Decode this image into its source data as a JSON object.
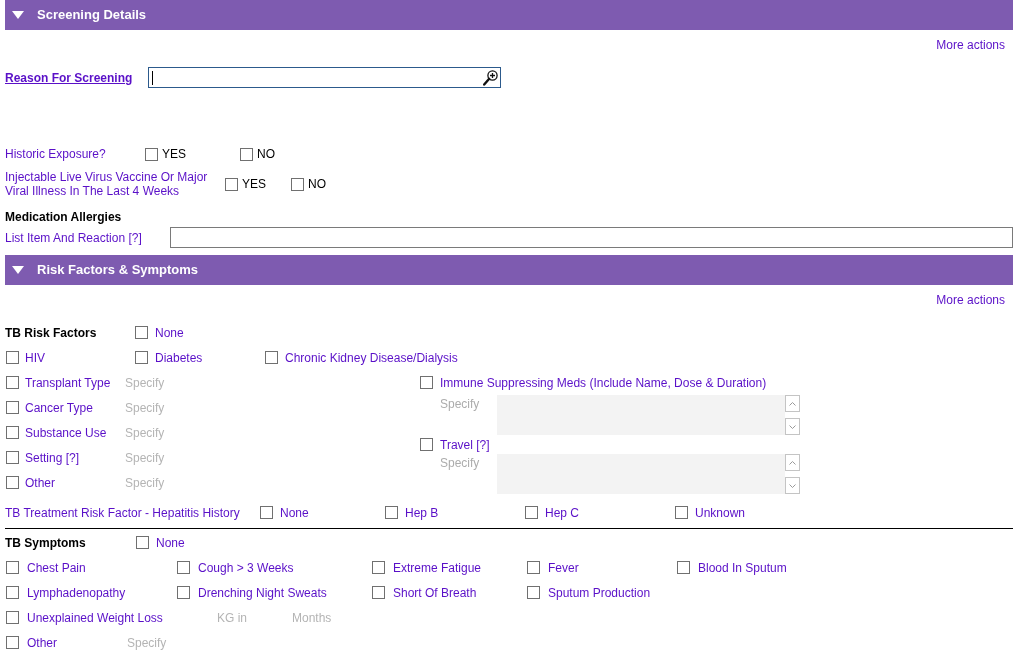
{
  "screening_details": {
    "header": {
      "title": "Screening Details",
      "expanded": true
    },
    "more_actions": "More actions",
    "reason_for_screening": {
      "label": "Reason For Screening",
      "focused": true
    },
    "questions": [
      {
        "label": "Historic Exposure?",
        "options": [
          {
            "label": "YES",
            "checked": false
          },
          {
            "label": "NO",
            "checked": false
          }
        ]
      },
      {
        "label": "Injectable Live Virus Vaccine Or Major Viral Illness In The Last 4 Weeks",
        "options": [
          {
            "label": "YES",
            "checked": false
          },
          {
            "label": "NO",
            "checked": false
          }
        ]
      }
    ],
    "medication_allergies": {
      "heading": "Medication Allergies",
      "label": "List Item And Reaction [?]"
    }
  },
  "risk_factors_and_symptoms": {
    "header": {
      "title": "Risk Factors & Symptoms",
      "expanded": true
    },
    "more_actions": "More actions",
    "tb_risk_factors": {
      "heading": "TB Risk Factors",
      "none": {
        "label": "None",
        "checked": false
      },
      "top_row": [
        {
          "label": "HIV",
          "checked": false
        },
        {
          "label": "Diabetes",
          "checked": false
        },
        {
          "label": "Chronic Kidney Disease/Dialysis",
          "checked": false
        }
      ],
      "left_items": [
        {
          "label": "Transplant Type",
          "checked": false,
          "placeholder": "Specify"
        },
        {
          "label": "Cancer Type",
          "checked": false,
          "placeholder": "Specify"
        },
        {
          "label": "Substance Use",
          "checked": false,
          "placeholder": "Specify"
        },
        {
          "label": "Setting [?]",
          "checked": false,
          "placeholder": "Specify"
        },
        {
          "label": "Other",
          "checked": false,
          "placeholder": "Specify"
        }
      ],
      "right_items": [
        {
          "label": "Immune Suppressing Meds (Include Name, Dose & Duration)",
          "checked": false,
          "specify_label": "Specify",
          "disabled": true
        },
        {
          "label": "Travel [?]",
          "checked": false,
          "specify_label": "Specify",
          "disabled": true
        }
      ]
    },
    "hepatitis_history": {
      "label": "TB Treatment Risk Factor - Hepatitis History",
      "options": [
        {
          "label": "None",
          "checked": false
        },
        {
          "label": "Hep B",
          "checked": false
        },
        {
          "label": "Hep C",
          "checked": false
        },
        {
          "label": "Unknown",
          "checked": false
        }
      ]
    },
    "tb_symptoms": {
      "heading": "TB Symptoms",
      "none": {
        "label": "None",
        "checked": false
      },
      "rows": [
        {
          "items": [
            {
              "label": "Chest Pain",
              "checked": false
            },
            {
              "label": "Cough > 3 Weeks",
              "checked": false
            },
            {
              "label": "Extreme Fatigue",
              "checked": false
            },
            {
              "label": "Fever",
              "checked": false
            },
            {
              "label": "Blood In Sputum",
              "checked": false
            }
          ]
        },
        {
          "items": [
            {
              "label": "Lymphadenopathy",
              "checked": false
            },
            {
              "label": "Drenching Night Sweats",
              "checked": false
            },
            {
              "label": "Short Of Breath",
              "checked": false
            },
            {
              "label": "Sputum Production",
              "checked": false
            }
          ]
        },
        {
          "items": [
            {
              "label": "Unexplained Weight Loss",
              "checked": false,
              "fields": [
                {
                  "placeholder": "KG in"
                },
                {
                  "placeholder": "Months"
                }
              ]
            }
          ]
        },
        {
          "items": [
            {
              "label": "Other",
              "checked": false,
              "fields": [
                {
                  "placeholder": "Specify"
                }
              ]
            }
          ]
        }
      ]
    }
  }
}
